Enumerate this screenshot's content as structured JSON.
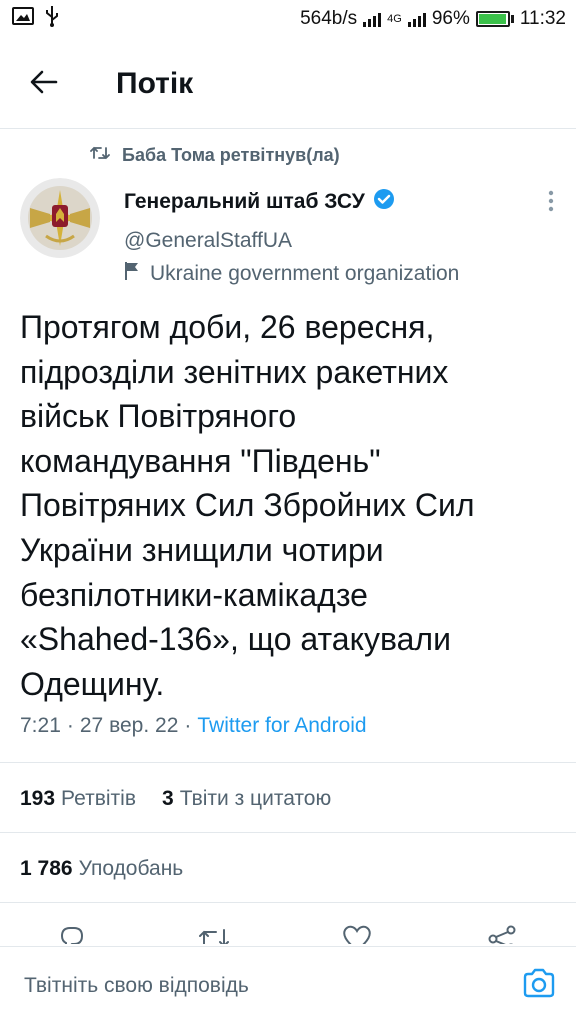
{
  "status_bar": {
    "net_speed": "564b/s",
    "network": "4G",
    "battery": "96%",
    "battery_level": 0.96,
    "time": "11:32",
    "icons": [
      "image-icon",
      "usb-icon",
      "signal-icon",
      "battery-icon"
    ]
  },
  "header": {
    "title": "Потік",
    "back_icon": "arrow-left-icon"
  },
  "retweeted_by": "Баба Тома ретвітнув(ла)",
  "author": {
    "name": "Генеральний штаб ЗСУ",
    "handle": "@GeneralStaffUA",
    "label": "Ukraine government organization",
    "verified": true
  },
  "tweet": {
    "text": "Протягом доби, 26 вересня,\nпідрозділи зенітних ракетних\nвійськ Повітряного\nкомандування \"Південь\"\nПовітряних Сил Збройних Сил\nУкраїни знищили чотири\nбезпілотники-камікадзе\n«Shahed-136», що атакували\nОдещину.",
    "time": "7:21",
    "sep1": "·",
    "date": "27 вер. 22",
    "sep2": "·",
    "source": "Twitter for Android"
  },
  "stats": {
    "retweets_count": "193",
    "retweets_label": "Ретвітів",
    "quotes_count": "3",
    "quotes_label": "Твіти з цитатою",
    "likes_count": "1 786",
    "likes_label": "Уподобань"
  },
  "actions": [
    "reply-icon",
    "retweet-icon",
    "like-icon",
    "share-icon"
  ],
  "reply": {
    "placeholder": "Твітніть свою відповідь",
    "camera_icon": "camera-icon"
  },
  "colors": {
    "link": "#1d9bf0",
    "secondary": "#536471",
    "battery": "#3bc14a"
  }
}
